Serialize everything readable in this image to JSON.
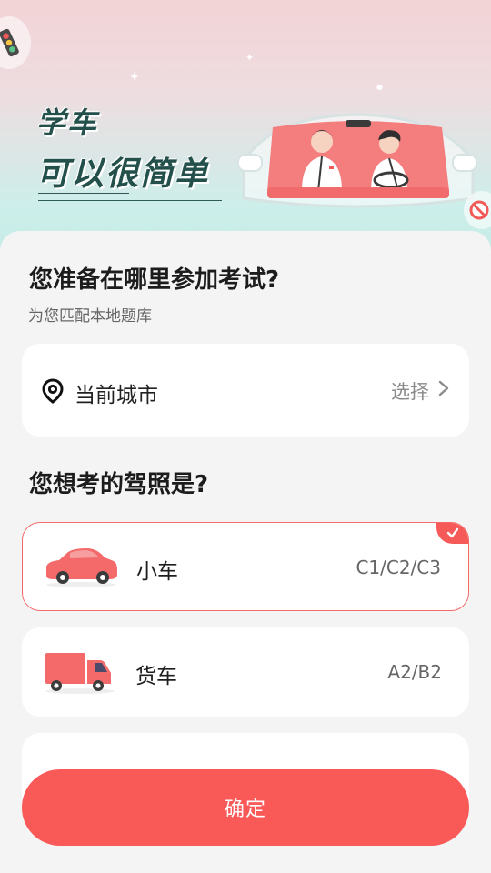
{
  "banner": {
    "slogan_line1": "学车",
    "slogan_line2": "可以很简单"
  },
  "location": {
    "heading": "您准备在哪里参加考试?",
    "subheading": "为您匹配本地题库",
    "city_label": "当前城市",
    "select_label": "选择"
  },
  "license": {
    "heading": "您想考的驾照是?",
    "options": [
      {
        "name": "小车",
        "code": "C1/C2/C3",
        "icon": "car-icon",
        "selected": true
      },
      {
        "name": "货车",
        "code": "A2/B2",
        "icon": "truck-icon",
        "selected": false
      },
      {
        "name": "",
        "code": "",
        "icon": "motorcycle-icon",
        "selected": false
      }
    ]
  },
  "confirm_label": "确定",
  "colors": {
    "accent": "#f95a58",
    "selected_border": "#f4696a",
    "banner_top": "#f3d3d6",
    "banner_bottom": "#c3ece6",
    "slogan": "#24504b"
  }
}
